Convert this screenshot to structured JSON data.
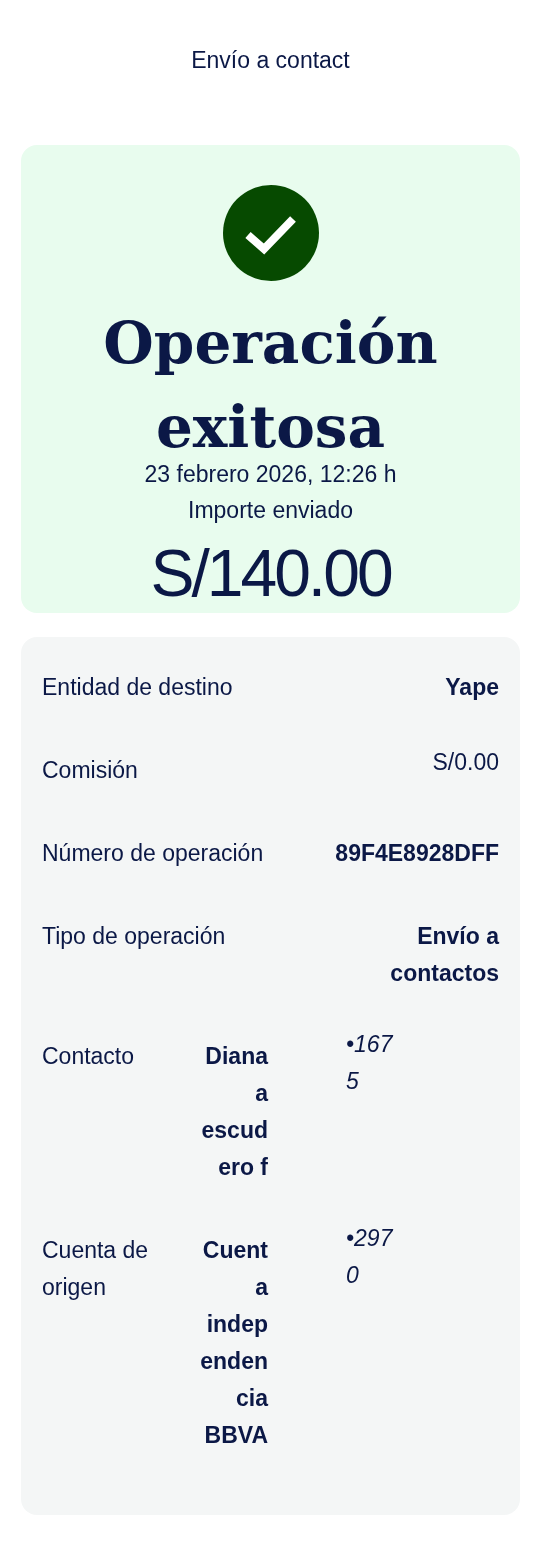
{
  "header": {
    "title": "Envío a contact"
  },
  "summary": {
    "status_title": "Operación exitosa",
    "date": "23 febrero 2026, 12:26 h",
    "amount_label": "Importe enviado",
    "amount": "S/140.00"
  },
  "details": [
    {
      "kind": "pair",
      "label": "Entidad de destino",
      "value": "Yape",
      "bold": true
    },
    {
      "kind": "pair",
      "label": "Comisión",
      "value": "S/0.00",
      "bold": false
    },
    {
      "kind": "pair",
      "label": "Número de operación",
      "value": "89F4E8928DFF",
      "bold": true
    },
    {
      "kind": "pair",
      "label": "Tipo de operación",
      "value": "Envío a contactos",
      "bold": true
    },
    {
      "kind": "triple",
      "label": "Contacto",
      "value": "Diana a escudero f",
      "masked": "•1675"
    },
    {
      "kind": "triple",
      "label": "Cuenta de origen",
      "value": "Cuenta independencia BBVA",
      "masked": "•2970"
    }
  ]
}
